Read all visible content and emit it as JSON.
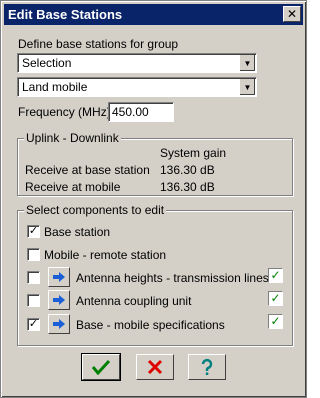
{
  "window": {
    "title": "Edit Base Stations",
    "close_glyph": "✕"
  },
  "define": {
    "label": "Define base stations for group",
    "group_value": "Selection",
    "type_value": "Land mobile"
  },
  "frequency": {
    "label": "Frequency (MHz)",
    "value": "450.00"
  },
  "uplink": {
    "legend": "Uplink - Downlink",
    "column_header": "System gain",
    "rows": [
      {
        "label": "Receive at base station",
        "value": "136.30 dB"
      },
      {
        "label": "Receive at mobile",
        "value": "136.30 dB"
      }
    ]
  },
  "components": {
    "legend": "Select components to edit",
    "items": [
      {
        "label": "Base station",
        "checked": true
      },
      {
        "label": "Mobile - remote station",
        "checked": false
      },
      {
        "label": "Antenna heights - transmission lines",
        "checked": false,
        "done": true
      },
      {
        "label": "Antenna coupling unit",
        "checked": false,
        "done": true
      },
      {
        "label": "Base - mobile specifications",
        "checked": true,
        "done": true
      }
    ]
  },
  "buttons": {
    "ok_icon": "check-icon",
    "cancel_icon": "x-icon",
    "help_icon": "question-icon"
  },
  "colors": {
    "titlebar": "#0a246a",
    "face": "#d4d0c8",
    "ok": "#008000",
    "cancel": "#e00000",
    "help": "#008080",
    "arrow": "#1a5fd6"
  }
}
